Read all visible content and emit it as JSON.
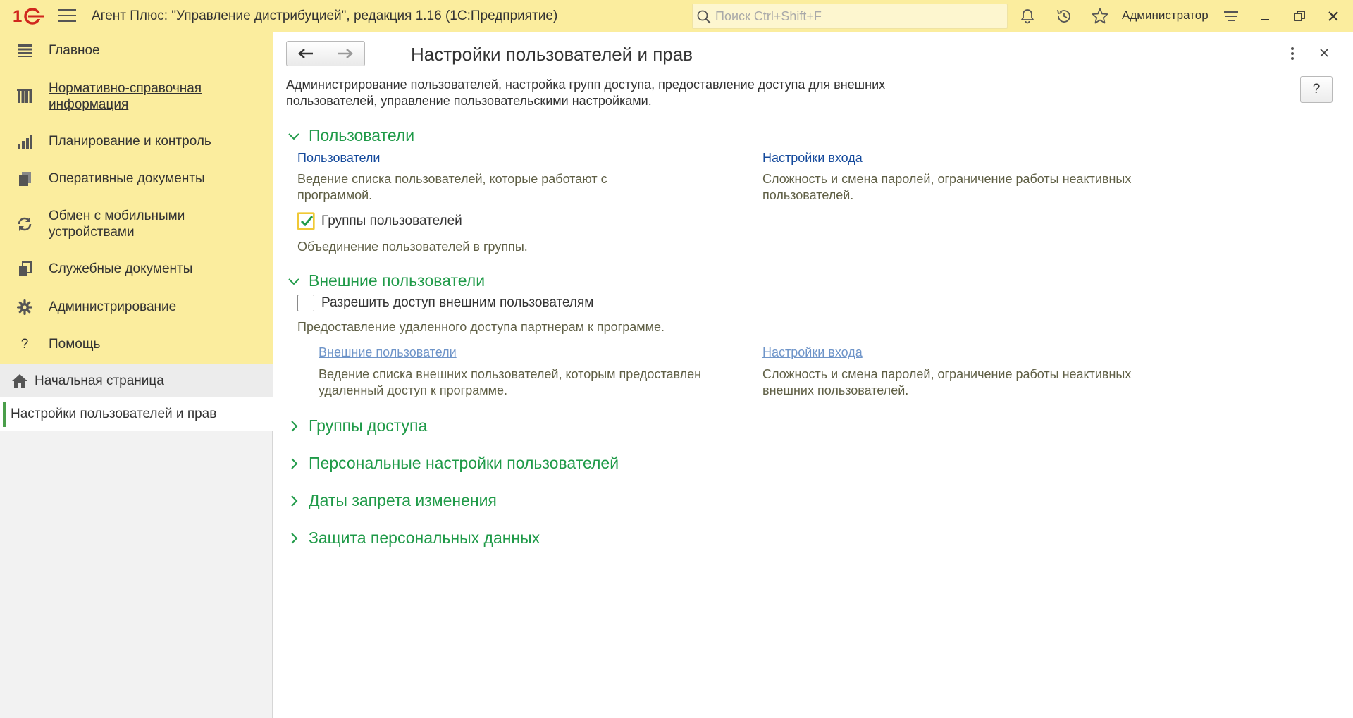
{
  "app": {
    "title": "Агент Плюс: \"Управление дистрибуцией\", редакция 1.16  (1С:Предприятие)",
    "search_placeholder": "Поиск Ctrl+Shift+F",
    "user": "Администратор"
  },
  "sidebar": {
    "menu": [
      {
        "label": "Главное",
        "icon": "list-icon"
      },
      {
        "label": "Нормативно-справочная информация",
        "icon": "books-icon"
      },
      {
        "label": "Планирование и контроль",
        "icon": "chart-icon"
      },
      {
        "label": "Оперативные документы",
        "icon": "documents-icon"
      },
      {
        "label": "Обмен с мобильными устройствами",
        "icon": "sync-icon"
      },
      {
        "label": "Служебные документы",
        "icon": "service-documents-icon"
      },
      {
        "label": "Администрирование",
        "icon": "gear-icon"
      },
      {
        "label": "Помощь",
        "icon": "question-icon"
      }
    ],
    "menu_lines": {
      "nsi_1": "Нормативно-справочная",
      "nsi_2": "информация",
      "mobile_1": "Обмен с мобильными",
      "mobile_2": "устройствами"
    },
    "home": "Начальная страница",
    "active_tab": "Настройки пользователей и прав"
  },
  "form": {
    "title": "Настройки пользователей и прав",
    "help": "?",
    "description": "Администрирование пользователей, настройка групп доступа, предоставление доступа для внешних пользователей, управление пользовательскими настройками.",
    "sections": {
      "users": {
        "title": "Пользователи",
        "users_link": "Пользователи",
        "users_note": "Ведение списка пользователей, которые работают с программой.",
        "login_link": "Настройки входа",
        "login_note": "Сложность и смена паролей, ограничение работы неактивных пользователей.",
        "groups_checkbox": "Группы пользователей",
        "groups_checked": true,
        "groups_note": "Объединение пользователей в группы."
      },
      "external": {
        "title": "Внешние пользователи",
        "allow_checkbox": "Разрешить доступ внешним пользователям",
        "allow_checked": false,
        "allow_note": "Предоставление удаленного доступа партнерам к программе.",
        "ext_users_link": "Внешние пользователи",
        "ext_users_note": "Ведение списка внешних пользователей, которым предоставлен удаленный доступ к программе.",
        "ext_login_link": "Настройки входа",
        "ext_login_note": "Сложность и смена паролей, ограничение работы неактивных внешних пользователей."
      },
      "access_groups": {
        "title": "Группы доступа"
      },
      "personal": {
        "title": "Персональные настройки пользователей"
      },
      "dates": {
        "title": "Даты запрета изменения"
      },
      "privacy": {
        "title": "Защита персональных данных"
      }
    }
  },
  "colors": {
    "titlebar_bg": "#fbed9e",
    "section_title": "#1f9a48",
    "link": "#154a9c",
    "checkbox_focus": "#f0c836"
  }
}
